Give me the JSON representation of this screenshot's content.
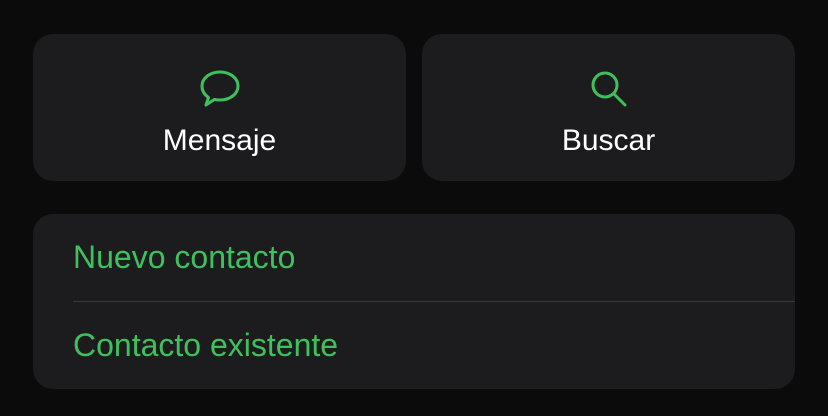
{
  "colors": {
    "background": "#0b0b0b",
    "card": "#1c1c1e",
    "accent": "#3ec15d",
    "text": "#ffffff",
    "divider": "#38383a"
  },
  "actions": [
    {
      "label": "Mensaje",
      "icon": "message-bubble-icon"
    },
    {
      "label": "Buscar",
      "icon": "search-icon"
    }
  ],
  "list": {
    "items": [
      {
        "label": "Nuevo contacto"
      },
      {
        "label": "Contacto existente"
      }
    ]
  }
}
